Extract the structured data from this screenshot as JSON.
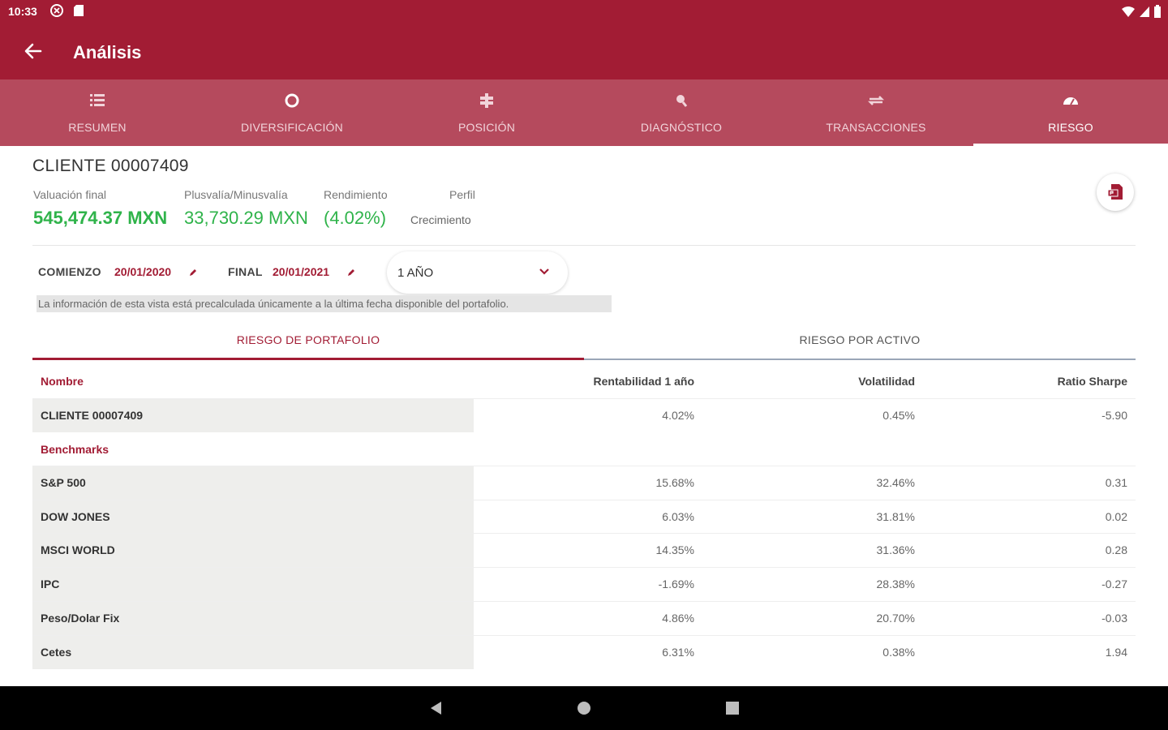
{
  "status_bar": {
    "time": "10:33"
  },
  "app_bar": {
    "title": "Análisis"
  },
  "tabs": [
    {
      "label": "RESUMEN",
      "icon": "list-icon"
    },
    {
      "label": "DIVERSIFICACIÓN",
      "icon": "donut-icon"
    },
    {
      "label": "POSICIÓN",
      "icon": "position-icon"
    },
    {
      "label": "DIAGNÓSTICO",
      "icon": "magnifier-icon"
    },
    {
      "label": "TRANSACCIONES",
      "icon": "transfer-icon"
    },
    {
      "label": "RIESGO",
      "icon": "gauge-icon",
      "active": true
    }
  ],
  "client": {
    "name": "CLIENTE 00007409",
    "metrics": {
      "valuacion_label": "Valuación final",
      "valuacion_value": "545,474.37 MXN",
      "plusvalia_label": "Plusvalía/Minusvalía",
      "plusvalia_value": "33,730.29 MXN",
      "rendimiento_label": "Rendimiento",
      "rendimiento_value": "(4.02%)",
      "perfil_label": "Perfil",
      "perfil_value": "Crecimiento"
    }
  },
  "dates": {
    "start_label": "COMIENZO",
    "start_value": "20/01/2020",
    "end_label": "FINAL",
    "end_value": "20/01/2021",
    "period_value": "1 AÑO"
  },
  "info_note": "La información de esta vista está precalculada únicamente a la última fecha disponible del portafolio.",
  "subtabs": {
    "portfolio": "RIESGO DE PORTAFOLIO",
    "asset": "RIESGO POR ACTIVO"
  },
  "table": {
    "headers": {
      "name": "Nombre",
      "rentabilidad": "Rentabilidad 1 año",
      "volatilidad": "Volatilidad",
      "sharpe": "Ratio Sharpe"
    },
    "client_row": {
      "name": "CLIENTE 00007409",
      "rentabilidad": "4.02%",
      "volatilidad": "0.45%",
      "sharpe": "-5.90"
    },
    "benchmarks_label": "Benchmarks",
    "benchmarks": [
      {
        "name": "S&P 500",
        "rentabilidad": "15.68%",
        "volatilidad": "32.46%",
        "sharpe": "0.31"
      },
      {
        "name": "DOW JONES",
        "rentabilidad": "6.03%",
        "volatilidad": "31.81%",
        "sharpe": "0.02"
      },
      {
        "name": "MSCI WORLD",
        "rentabilidad": "14.35%",
        "volatilidad": "31.36%",
        "sharpe": "0.28"
      },
      {
        "name": "IPC",
        "rentabilidad": "-1.69%",
        "volatilidad": "28.38%",
        "sharpe": "-0.27"
      },
      {
        "name": "Peso/Dolar Fix",
        "rentabilidad": "4.86%",
        "volatilidad": "20.70%",
        "sharpe": "-0.03"
      },
      {
        "name": "Cetes",
        "rentabilidad": "6.31%",
        "volatilidad": "0.38%",
        "sharpe": "1.94"
      }
    ]
  },
  "colors": {
    "brand": "#a21c34",
    "tab_bar": "#b54a5d",
    "positive": "#2fb34a"
  }
}
